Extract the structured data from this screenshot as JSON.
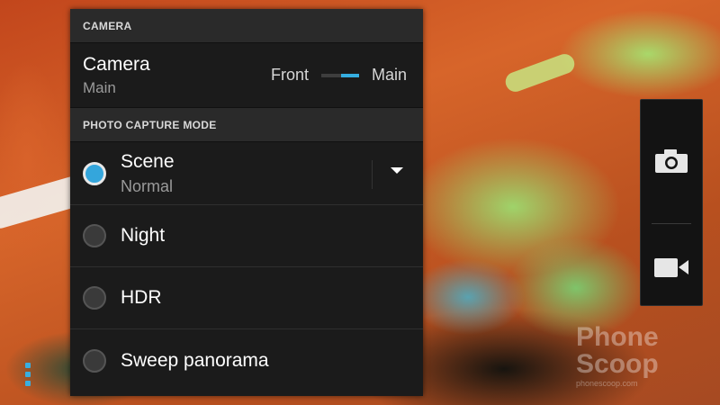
{
  "camera_section": {
    "header": "CAMERA",
    "setting_title": "Camera",
    "setting_value": "Main",
    "switch_left": "Front",
    "switch_right": "Main"
  },
  "capture_section": {
    "header": "PHOTO CAPTURE MODE",
    "modes": [
      {
        "label": "Scene",
        "value": "Normal",
        "selected": true,
        "has_dropdown": true
      },
      {
        "label": "Night",
        "selected": false
      },
      {
        "label": "HDR",
        "selected": false
      },
      {
        "label": "Sweep panorama",
        "selected": false
      }
    ]
  },
  "shutter_bar": {
    "buttons": [
      {
        "icon": "camera-icon"
      },
      {
        "icon": "video-camera-icon"
      }
    ]
  },
  "watermark": {
    "brand": "Phone Scoop",
    "url": "phonescoop.com"
  },
  "colors": {
    "accent": "#34a6dc",
    "panel": "#1b1b1b",
    "section_header": "#2a2a2a"
  }
}
